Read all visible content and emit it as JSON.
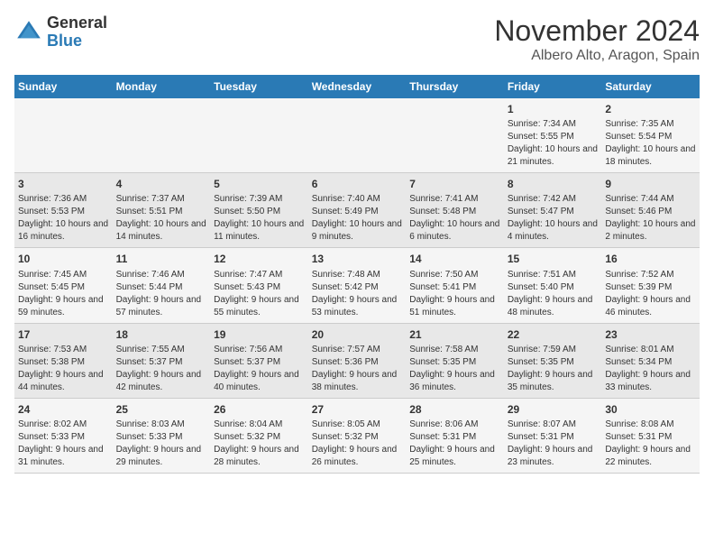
{
  "header": {
    "logo_general": "General",
    "logo_blue": "Blue",
    "month_title": "November 2024",
    "location": "Albero Alto, Aragon, Spain"
  },
  "days_of_week": [
    "Sunday",
    "Monday",
    "Tuesday",
    "Wednesday",
    "Thursday",
    "Friday",
    "Saturday"
  ],
  "weeks": [
    [
      {
        "day": "",
        "info": ""
      },
      {
        "day": "",
        "info": ""
      },
      {
        "day": "",
        "info": ""
      },
      {
        "day": "",
        "info": ""
      },
      {
        "day": "",
        "info": ""
      },
      {
        "day": "1",
        "info": "Sunrise: 7:34 AM\nSunset: 5:55 PM\nDaylight: 10 hours and 21 minutes."
      },
      {
        "day": "2",
        "info": "Sunrise: 7:35 AM\nSunset: 5:54 PM\nDaylight: 10 hours and 18 minutes."
      }
    ],
    [
      {
        "day": "3",
        "info": "Sunrise: 7:36 AM\nSunset: 5:53 PM\nDaylight: 10 hours and 16 minutes."
      },
      {
        "day": "4",
        "info": "Sunrise: 7:37 AM\nSunset: 5:51 PM\nDaylight: 10 hours and 14 minutes."
      },
      {
        "day": "5",
        "info": "Sunrise: 7:39 AM\nSunset: 5:50 PM\nDaylight: 10 hours and 11 minutes."
      },
      {
        "day": "6",
        "info": "Sunrise: 7:40 AM\nSunset: 5:49 PM\nDaylight: 10 hours and 9 minutes."
      },
      {
        "day": "7",
        "info": "Sunrise: 7:41 AM\nSunset: 5:48 PM\nDaylight: 10 hours and 6 minutes."
      },
      {
        "day": "8",
        "info": "Sunrise: 7:42 AM\nSunset: 5:47 PM\nDaylight: 10 hours and 4 minutes."
      },
      {
        "day": "9",
        "info": "Sunrise: 7:44 AM\nSunset: 5:46 PM\nDaylight: 10 hours and 2 minutes."
      }
    ],
    [
      {
        "day": "10",
        "info": "Sunrise: 7:45 AM\nSunset: 5:45 PM\nDaylight: 9 hours and 59 minutes."
      },
      {
        "day": "11",
        "info": "Sunrise: 7:46 AM\nSunset: 5:44 PM\nDaylight: 9 hours and 57 minutes."
      },
      {
        "day": "12",
        "info": "Sunrise: 7:47 AM\nSunset: 5:43 PM\nDaylight: 9 hours and 55 minutes."
      },
      {
        "day": "13",
        "info": "Sunrise: 7:48 AM\nSunset: 5:42 PM\nDaylight: 9 hours and 53 minutes."
      },
      {
        "day": "14",
        "info": "Sunrise: 7:50 AM\nSunset: 5:41 PM\nDaylight: 9 hours and 51 minutes."
      },
      {
        "day": "15",
        "info": "Sunrise: 7:51 AM\nSunset: 5:40 PM\nDaylight: 9 hours and 48 minutes."
      },
      {
        "day": "16",
        "info": "Sunrise: 7:52 AM\nSunset: 5:39 PM\nDaylight: 9 hours and 46 minutes."
      }
    ],
    [
      {
        "day": "17",
        "info": "Sunrise: 7:53 AM\nSunset: 5:38 PM\nDaylight: 9 hours and 44 minutes."
      },
      {
        "day": "18",
        "info": "Sunrise: 7:55 AM\nSunset: 5:37 PM\nDaylight: 9 hours and 42 minutes."
      },
      {
        "day": "19",
        "info": "Sunrise: 7:56 AM\nSunset: 5:37 PM\nDaylight: 9 hours and 40 minutes."
      },
      {
        "day": "20",
        "info": "Sunrise: 7:57 AM\nSunset: 5:36 PM\nDaylight: 9 hours and 38 minutes."
      },
      {
        "day": "21",
        "info": "Sunrise: 7:58 AM\nSunset: 5:35 PM\nDaylight: 9 hours and 36 minutes."
      },
      {
        "day": "22",
        "info": "Sunrise: 7:59 AM\nSunset: 5:35 PM\nDaylight: 9 hours and 35 minutes."
      },
      {
        "day": "23",
        "info": "Sunrise: 8:01 AM\nSunset: 5:34 PM\nDaylight: 9 hours and 33 minutes."
      }
    ],
    [
      {
        "day": "24",
        "info": "Sunrise: 8:02 AM\nSunset: 5:33 PM\nDaylight: 9 hours and 31 minutes."
      },
      {
        "day": "25",
        "info": "Sunrise: 8:03 AM\nSunset: 5:33 PM\nDaylight: 9 hours and 29 minutes."
      },
      {
        "day": "26",
        "info": "Sunrise: 8:04 AM\nSunset: 5:32 PM\nDaylight: 9 hours and 28 minutes."
      },
      {
        "day": "27",
        "info": "Sunrise: 8:05 AM\nSunset: 5:32 PM\nDaylight: 9 hours and 26 minutes."
      },
      {
        "day": "28",
        "info": "Sunrise: 8:06 AM\nSunset: 5:31 PM\nDaylight: 9 hours and 25 minutes."
      },
      {
        "day": "29",
        "info": "Sunrise: 8:07 AM\nSunset: 5:31 PM\nDaylight: 9 hours and 23 minutes."
      },
      {
        "day": "30",
        "info": "Sunrise: 8:08 AM\nSunset: 5:31 PM\nDaylight: 9 hours and 22 minutes."
      }
    ]
  ]
}
